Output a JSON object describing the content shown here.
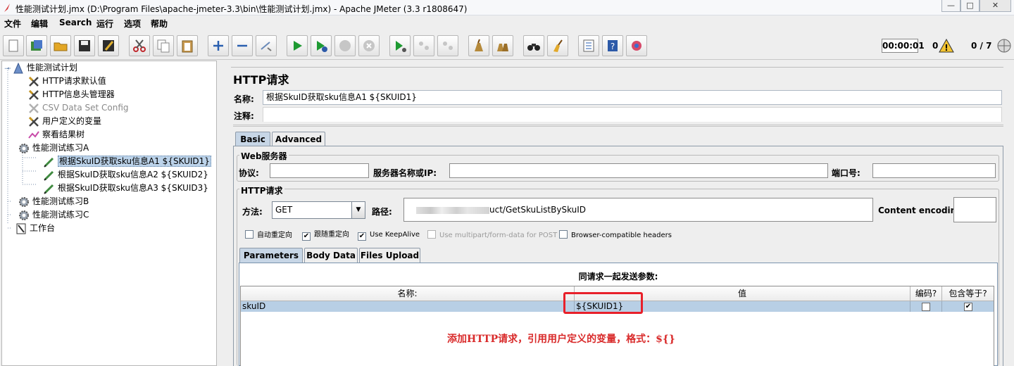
{
  "window": {
    "title": "性能测试计划.jmx (D:\\Program Files\\apache-jmeter-3.3\\bin\\性能测试计划.jmx) - Apache JMeter (3.3 r1808647)",
    "minimize": "—",
    "maximize": "□",
    "close": "✕"
  },
  "menu": [
    "文件",
    "编辑",
    "Search",
    "运行",
    "选项",
    "帮助"
  ],
  "status": {
    "timer": "00:00:01",
    "errors": "0",
    "threads": "0 / 7"
  },
  "tree": [
    {
      "label": "性能测试计划",
      "icon": "test-plan-icon"
    },
    {
      "label": "HTTP请求默认值",
      "icon": "config-element-icon"
    },
    {
      "label": "HTTP信息头管理器",
      "icon": "config-element-icon"
    },
    {
      "label": "CSV Data Set Config",
      "icon": "config-element-icon",
      "disabled": true
    },
    {
      "label": "用户定义的变量",
      "icon": "config-element-icon"
    },
    {
      "label": "察看结果树",
      "icon": "listener-icon"
    },
    {
      "label": "性能测试练习A",
      "icon": "thread-group-icon"
    },
    {
      "label": "根据SkuID获取sku信息A1 ${SKUID1}",
      "icon": "sampler-icon",
      "selected": true
    },
    {
      "label": "根据SkuID获取sku信息A2 ${SKUID2}",
      "icon": "sampler-icon"
    },
    {
      "label": "根据SkuID获取sku信息A3 ${SKUID3}",
      "icon": "sampler-icon"
    },
    {
      "label": "性能测试练习B",
      "icon": "thread-group-icon"
    },
    {
      "label": "性能测试练习C",
      "icon": "thread-group-icon"
    },
    {
      "label": "工作台",
      "icon": "workbench-icon"
    }
  ],
  "sampler": {
    "title": "HTTP请求",
    "name_label": "名称:",
    "name_value": "根据SkuID获取sku信息A1 ${SKUID1}",
    "comment_label": "注释:",
    "tabs": [
      "Basic",
      "Advanced"
    ],
    "web_server_title": "Web服务器",
    "protocol_label": "协议:",
    "server_label": "服务器名称或IP:",
    "port_label": "端口号:",
    "http_request_title": "HTTP请求",
    "method_label": "方法:",
    "method_value": "GET",
    "path_label": "路径:",
    "path_value": "uct/GetSkuListBySkuID",
    "encoding_label": "Content encoding:",
    "checkboxes": [
      {
        "label": "自动重定向",
        "checked": false
      },
      {
        "label": "跟随重定向",
        "checked": true
      },
      {
        "label": "Use KeepAlive",
        "checked": true
      },
      {
        "label": "Use multipart/form-data for POST",
        "checked": false,
        "disabled": true
      },
      {
        "label": "Browser-compatible headers",
        "checked": false
      }
    ],
    "param_tabs": [
      "Parameters",
      "Body Data",
      "Files Upload"
    ],
    "params_title": "同请求一起发送参数:",
    "columns": [
      "名称:",
      "值",
      "编码?",
      "包含等于?"
    ],
    "rows": [
      {
        "name": "skuID",
        "value": "${SKUID1}",
        "encode": false,
        "include_equals": true
      }
    ]
  },
  "annotation": "添加HTTP请求，引用用户定义的变量，格式：${}"
}
